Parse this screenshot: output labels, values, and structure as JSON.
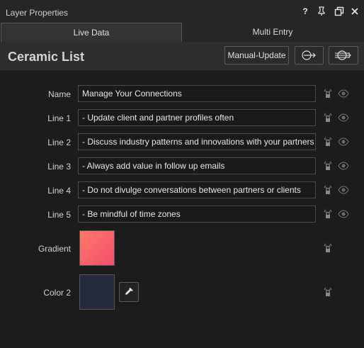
{
  "window": {
    "title": "Layer Properties"
  },
  "tabs": [
    {
      "label": "Live Data"
    },
    {
      "label": "Multi Entry"
    }
  ],
  "layer": {
    "name": "Ceramic List"
  },
  "toolbar": {
    "manual_update_label": "Manual-Update"
  },
  "fields": [
    {
      "label": "Name",
      "value": "Manage Your Connections"
    },
    {
      "label": "Line 1",
      "value": "- Update client and partner profiles often"
    },
    {
      "label": "Line 2",
      "value": "- Discuss industry patterns and innovations with your partners"
    },
    {
      "label": "Line 3",
      "value": "- Always add value in follow up emails"
    },
    {
      "label": "Line 4",
      "value": "- Do not divulge conversations between partners or clients"
    },
    {
      "label": "Line 5",
      "value": "- Be mindful of time zones"
    }
  ],
  "gradient": {
    "label": "Gradient",
    "color_start": "#ff7a6a",
    "color_end": "#f24e6c"
  },
  "color2": {
    "label": "Color 2",
    "color": "#222a3b"
  },
  "colors": {
    "background": "#1c1c1c",
    "panel": "#2e2e2e",
    "field_border": "#4a4a4a"
  }
}
